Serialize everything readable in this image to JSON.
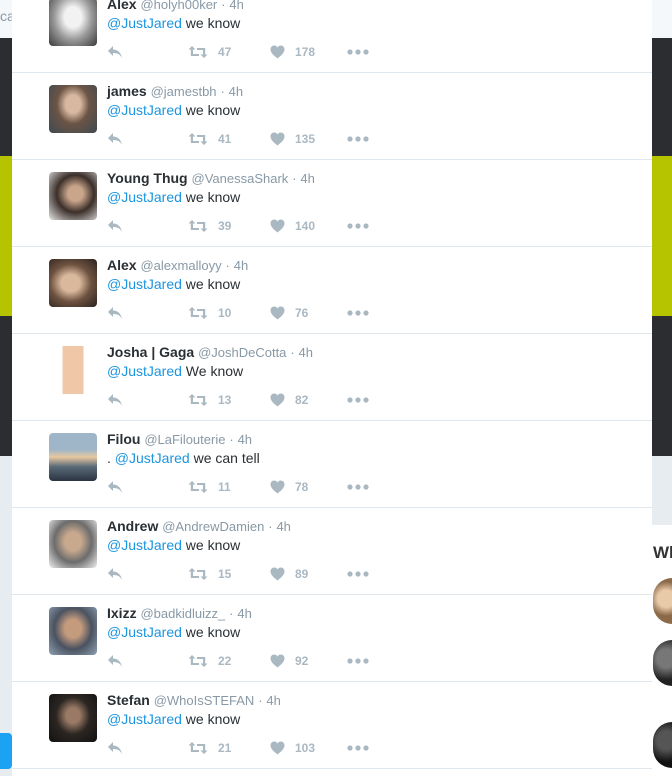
{
  "background": {
    "left_text": "ca",
    "right_text": "Wh"
  },
  "colors": {
    "mention": "#1b95e0",
    "name": "#292f33",
    "muted": "#8899a6",
    "action": "#aab8c2"
  },
  "tweets": [
    {
      "name": "Alex",
      "handle": "@holyh00ker",
      "time": "4h",
      "prefix": "",
      "mention": "@JustJared",
      "text": " we know",
      "retweets": "47",
      "likes": "178"
    },
    {
      "name": "james",
      "handle": "@jamestbh",
      "time": "4h",
      "prefix": "",
      "mention": "@JustJared",
      "text": " we know",
      "retweets": "41",
      "likes": "135"
    },
    {
      "name": "Young Thug",
      "handle": "@VanessaShark",
      "time": "4h",
      "prefix": "",
      "mention": "@JustJared",
      "text": " we know",
      "retweets": "39",
      "likes": "140"
    },
    {
      "name": "Alex",
      "handle": "@alexmalloyy",
      "time": "4h",
      "prefix": "",
      "mention": "@JustJared",
      "text": " we know",
      "retweets": "10",
      "likes": "76"
    },
    {
      "name": "Josha | Gaga",
      "handle": "@JoshDeCotta",
      "time": "4h",
      "prefix": "",
      "mention": "@JustJared",
      "text": " We know",
      "retweets": "13",
      "likes": "82"
    },
    {
      "name": "Filou",
      "handle": "@LaFilouterie",
      "time": "4h",
      "prefix": ". ",
      "mention": "@JustJared",
      "text": " we can tell",
      "retweets": "11",
      "likes": "78"
    },
    {
      "name": "Andrew",
      "handle": "@AndrewDamien",
      "time": "4h",
      "prefix": "",
      "mention": "@JustJared",
      "text": " we know",
      "retweets": "15",
      "likes": "89"
    },
    {
      "name": "Ixizz",
      "handle": "@badkidluizz_",
      "time": "4h",
      "prefix": "",
      "mention": "@JustJared",
      "text": " we know",
      "retweets": "22",
      "likes": "92"
    },
    {
      "name": "Stefan",
      "handle": "@WhoIsSTEFAN",
      "time": "4h",
      "prefix": "",
      "mention": "@JustJared",
      "text": " we know",
      "retweets": "21",
      "likes": "103"
    }
  ]
}
